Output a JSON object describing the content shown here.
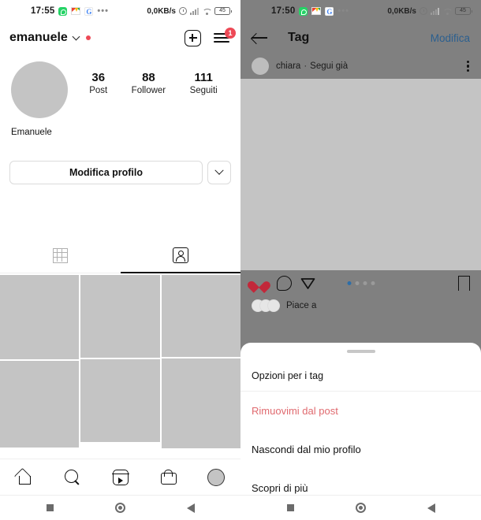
{
  "left": {
    "status_bar": {
      "time": "17:55",
      "icons": [
        "whatsapp-icon",
        "gmail-icon",
        "google-icon",
        "overflow-dots-icon"
      ],
      "network_speed": "0,0KB/s",
      "right_icons": [
        "alarm-icon",
        "signal-icon",
        "wifi-icon"
      ],
      "battery": "45"
    },
    "header": {
      "username": "emanuele",
      "chevron": "chevron-down-icon",
      "status_dot": "red-dot",
      "add_button": "plus-square-icon",
      "menu_button": "hamburger-icon",
      "menu_badge": "1"
    },
    "profile": {
      "avatar": "profile-avatar",
      "display_name": "Emanuele",
      "stats": [
        {
          "value": "36",
          "label": "Post"
        },
        {
          "value": "88",
          "label": "Follower"
        },
        {
          "value": "111",
          "label": "Seguiti"
        }
      ],
      "edit_button": "Modifica profilo",
      "dropdown_button": "chevron-down-icon"
    },
    "tabs": [
      {
        "name": "grid-tab",
        "icon": "grid-icon",
        "active": false
      },
      {
        "name": "tagged-tab",
        "icon": "tagged-person-icon",
        "active": true
      }
    ],
    "bottom_nav": [
      {
        "name": "home",
        "icon": "home-icon"
      },
      {
        "name": "search",
        "icon": "search-icon"
      },
      {
        "name": "reels",
        "icon": "reels-icon"
      },
      {
        "name": "shop",
        "icon": "shop-bag-icon"
      },
      {
        "name": "profile",
        "icon": "profile-avatar-icon"
      }
    ],
    "android_nav": [
      "recents-square-icon",
      "home-circle-icon",
      "back-triangle-icon"
    ]
  },
  "right": {
    "status_bar": {
      "time": "17:50",
      "icons": [
        "whatsapp-icon",
        "gmail-icon",
        "google-icon",
        "overflow-dots-icon"
      ],
      "network_speed": "0,0KB/s",
      "right_icons": [
        "alarm-icon",
        "signal-icon",
        "wifi-icon"
      ],
      "battery": "45"
    },
    "app_bar": {
      "back": "back-arrow-icon",
      "title": "Tag",
      "action": "Modifica",
      "action_color": "#2b5f8f"
    },
    "post": {
      "avatar": "post-author-avatar",
      "username": "chiara",
      "separator": "·",
      "follow_state": "Segui già",
      "more": "kebab-menu-icon",
      "image": "post-image-placeholder",
      "actions": {
        "like": "heart-icon-filled",
        "like_color": "#c2283a",
        "comment": "comment-icon",
        "share": "share-icon",
        "save": "bookmark-icon"
      },
      "carousel": {
        "count": 4,
        "active_index": 0,
        "active_color": "#2d6ea8"
      },
      "likes_text": "Piace a"
    },
    "sheet": {
      "handle": "drag-handle",
      "title": "Opzioni per i tag",
      "items": [
        {
          "label": "Rimuovimi dal post",
          "danger": true
        },
        {
          "label": "Nascondi dal mio profilo",
          "danger": false
        },
        {
          "label": "Scopri di più",
          "danger": false
        }
      ]
    },
    "android_nav": [
      "recents-square-icon",
      "home-circle-icon",
      "back-triangle-icon"
    ]
  }
}
